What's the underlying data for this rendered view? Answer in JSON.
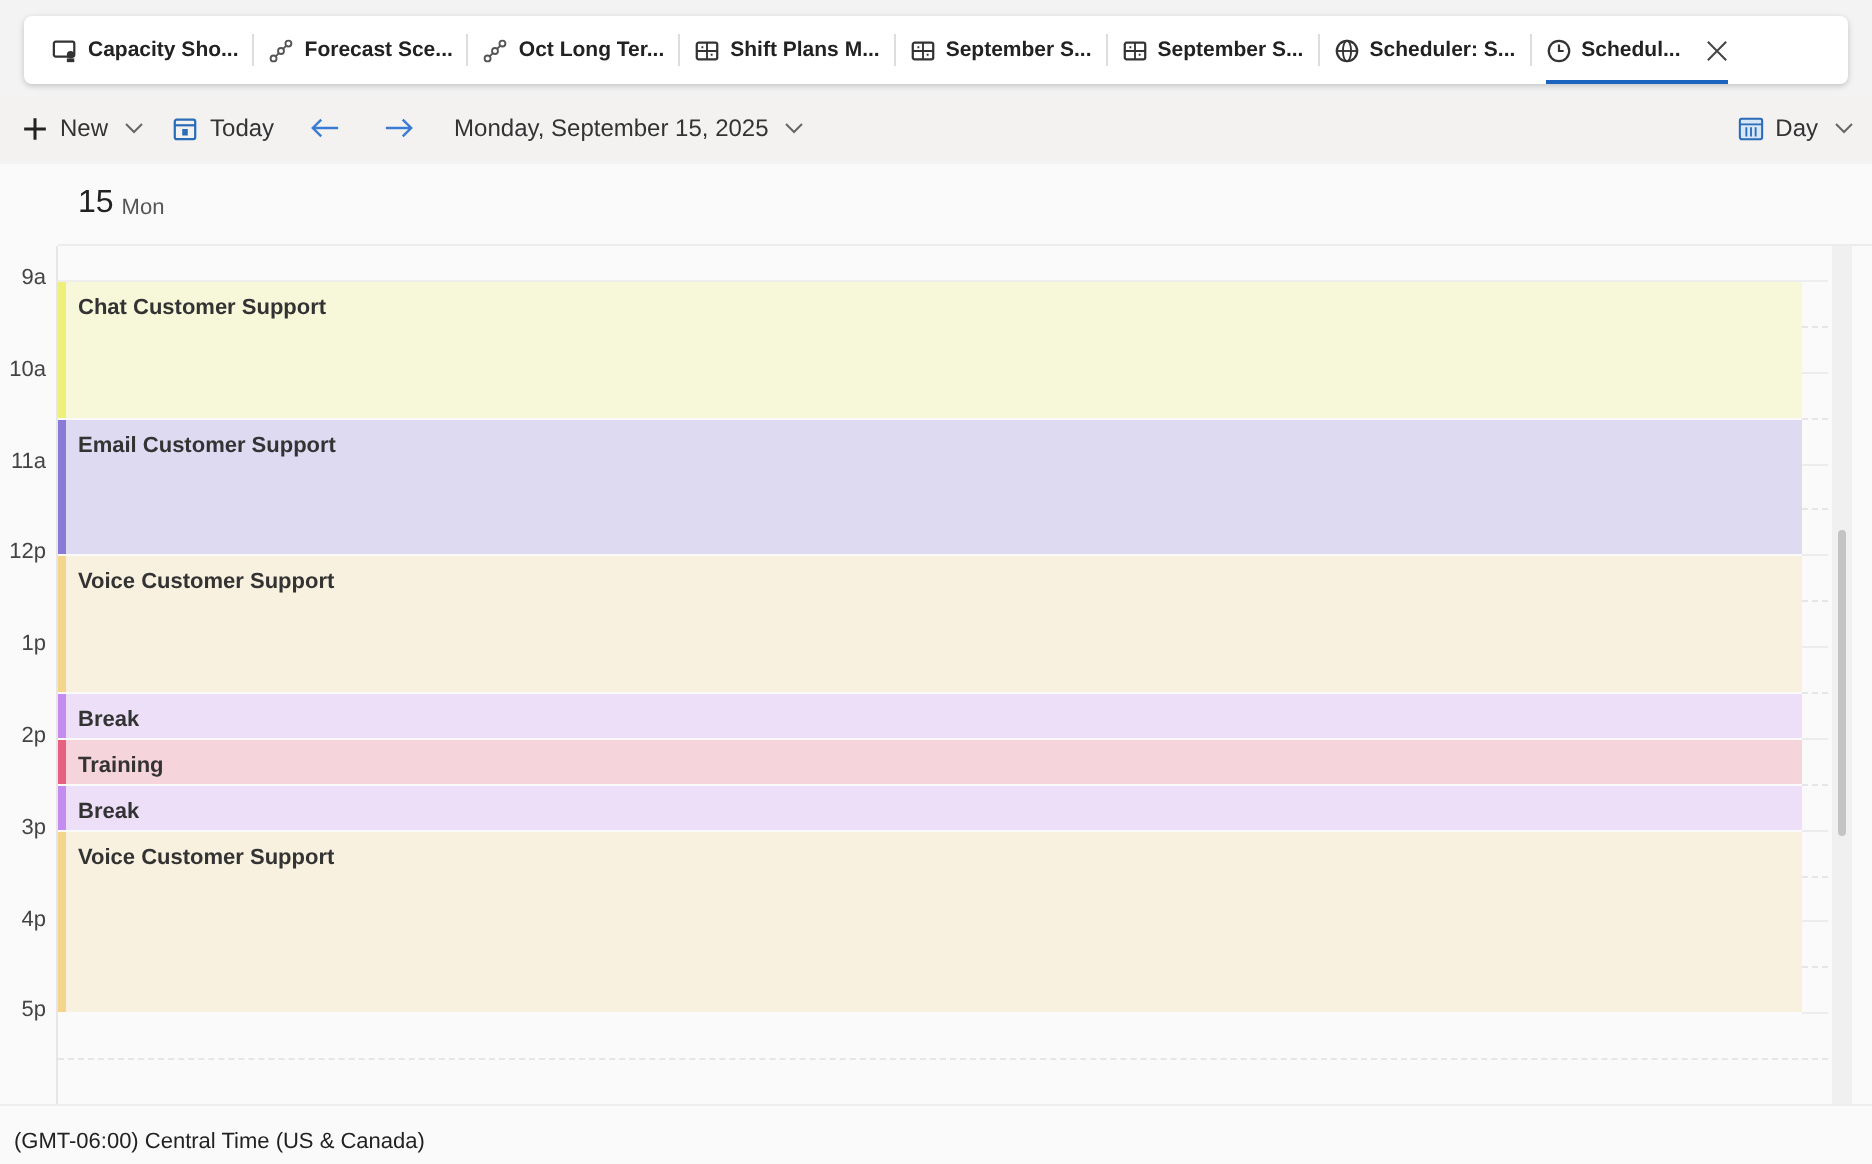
{
  "tabs": [
    {
      "label": "Capacity Sho...",
      "kind": "monitor",
      "selected": false
    },
    {
      "label": "Forecast Sce...",
      "kind": "nodes",
      "selected": false
    },
    {
      "label": "Oct Long Ter...",
      "kind": "nodes",
      "selected": false
    },
    {
      "label": "Shift Plans M...",
      "kind": "grid",
      "selected": false
    },
    {
      "label": "September S...",
      "kind": "grid",
      "selected": false
    },
    {
      "label": "September S...",
      "kind": "grid",
      "selected": false
    },
    {
      "label": "Scheduler: S...",
      "kind": "globe",
      "selected": false
    },
    {
      "label": "Schedul...",
      "kind": "clock",
      "selected": true
    }
  ],
  "toolbar": {
    "new": "New",
    "today": "Today",
    "date": "Monday, September 15, 2025",
    "view": "Day"
  },
  "day_header": {
    "day": "15",
    "weekday": "Mon"
  },
  "hours": [
    "9a",
    "10a",
    "11a",
    "12p",
    "1p",
    "2p",
    "3p",
    "4p",
    "5p"
  ],
  "events": [
    {
      "title": "Chat Customer Support",
      "kind": "standard",
      "color": "#eef07a"
    },
    {
      "title": "Email Customer Support",
      "kind": "standard",
      "color": "#8b79d8"
    },
    {
      "title": "Voice Customer Support",
      "kind": "standard",
      "color": "#f5d58c"
    },
    {
      "title": "Break",
      "kind": "brief",
      "color": "#c58cf0"
    },
    {
      "title": "Training",
      "kind": "brief",
      "color": "#e8607f"
    },
    {
      "title": "Break",
      "kind": "brief",
      "color": "#c58cf0"
    },
    {
      "title": "Voice Customer Support",
      "kind": "extended",
      "color": "#f5d58c"
    }
  ],
  "status_bar": {
    "timezone": "(GMT-06:00) Central Time (US & Canada)"
  }
}
